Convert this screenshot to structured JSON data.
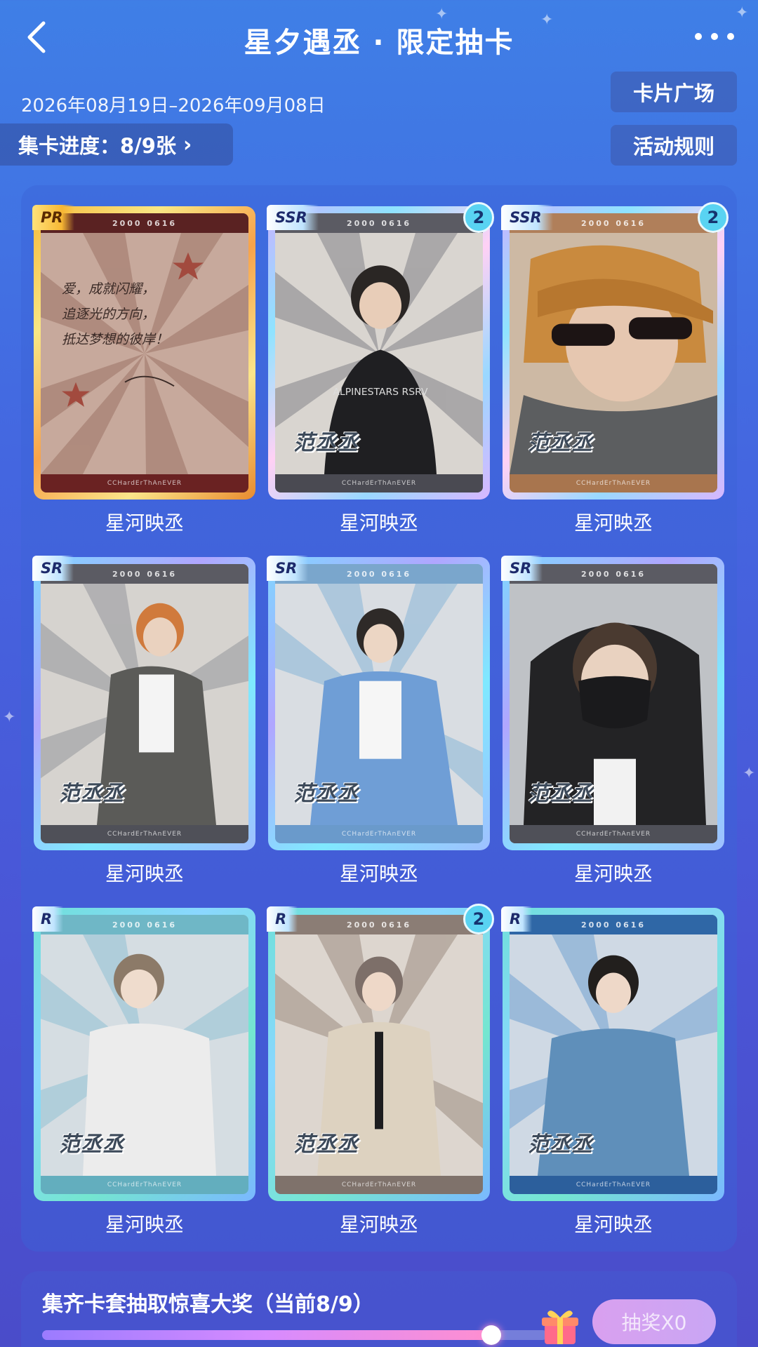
{
  "header": {
    "back_icon": "chevron-left-icon",
    "title": "星夕遇丞 · 限定抽卡",
    "more_icon": "ellipsis-icon"
  },
  "event": {
    "date_range": "2026年08月19日–2026年09月08日",
    "card_plaza_label": "卡片广场",
    "rules_label": "活动规则",
    "progress_label": "集卡进度：8/9张",
    "progress_chevron": "›"
  },
  "card_meta": {
    "top_strip": "2000 0616",
    "bottom_strip": "CCHardErThAnEVER",
    "name_stamp": "范丞丞"
  },
  "cards": [
    {
      "rarity": "PR",
      "count": "",
      "label": "星河映丞",
      "frame": "pr",
      "note": [
        "爱，成就闪耀，",
        "追逐光的方向，",
        "抵达梦想的彼岸！"
      ]
    },
    {
      "rarity": "SSR",
      "count": "2",
      "label": "星河映丞",
      "frame": "ssr"
    },
    {
      "rarity": "SSR",
      "count": "2",
      "label": "星河映丞",
      "frame": "ssr"
    },
    {
      "rarity": "SR",
      "count": "",
      "label": "星河映丞",
      "frame": "sr"
    },
    {
      "rarity": "SR",
      "count": "",
      "label": "星河映丞",
      "frame": "sr"
    },
    {
      "rarity": "SR",
      "count": "",
      "label": "星河映丞",
      "frame": "sr"
    },
    {
      "rarity": "R",
      "count": "",
      "label": "星河映丞",
      "frame": "r"
    },
    {
      "rarity": "R",
      "count": "2",
      "label": "星河映丞",
      "frame": "r"
    },
    {
      "rarity": "R",
      "count": "",
      "label": "星河映丞",
      "frame": "r"
    }
  ],
  "prize": {
    "title": "集齐卡套抽取惊喜大奖（当前8/9）",
    "progress": 0.889,
    "gift_icon": "gift-box-icon",
    "draw_label": "抽奖X0"
  },
  "colors": {
    "background_top": "#3f7fe6",
    "background_bottom": "#4a4cc9",
    "badge": "#59d3f2"
  }
}
